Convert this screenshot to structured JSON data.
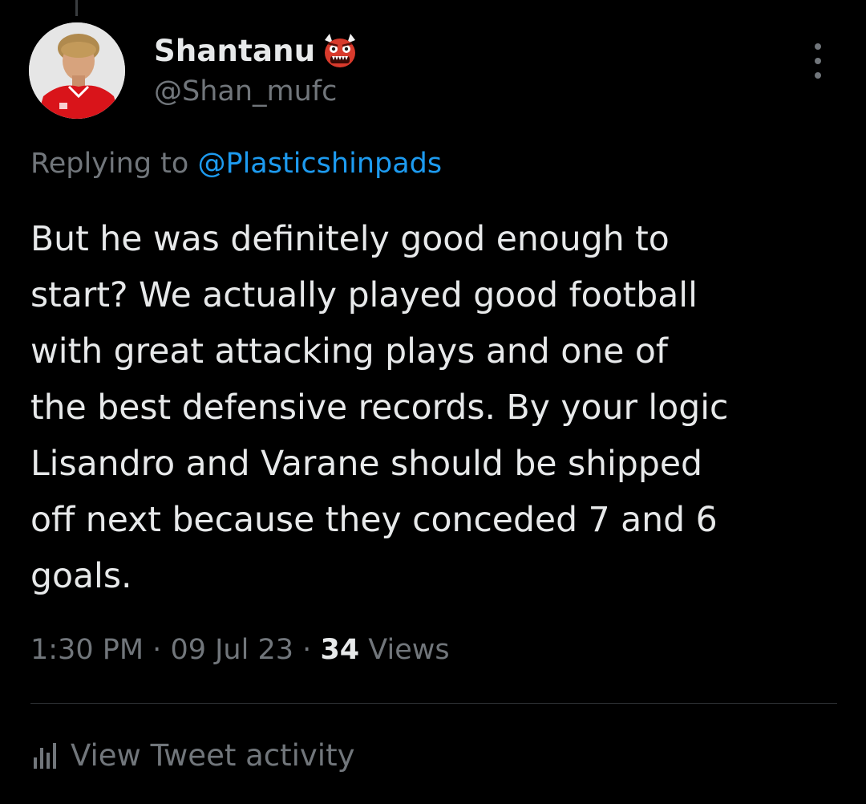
{
  "tweet": {
    "author": {
      "display_name": "Shantanu",
      "name_emoji": "ogre-emoji",
      "handle": "@Shan_mufc",
      "avatar": "profile-photo"
    },
    "replying_to": {
      "prefix": "Replying to",
      "mention": "@Plasticshinpads"
    },
    "text": "But he was definitely good enough to\nstart? We actually played good football\nwith great attacking plays and one of\nthe best defensive records. By your logic\nLisandro and Varane should be shipped\noff next because they conceded 7 and 6\ngoals.",
    "meta": {
      "time": "1:30 PM",
      "date": "09 Jul 23",
      "separator": "·",
      "views_count": "34",
      "views_label": "Views"
    },
    "activity": {
      "icon": "bar-chart-icon",
      "label": "View Tweet activity"
    },
    "more_icon": "more-vertical-icon"
  },
  "colors": {
    "background": "#000000",
    "primary_text": "#e7e9ea",
    "secondary_text": "#71767b",
    "link": "#1d9bf0",
    "divider": "#2f3336"
  }
}
